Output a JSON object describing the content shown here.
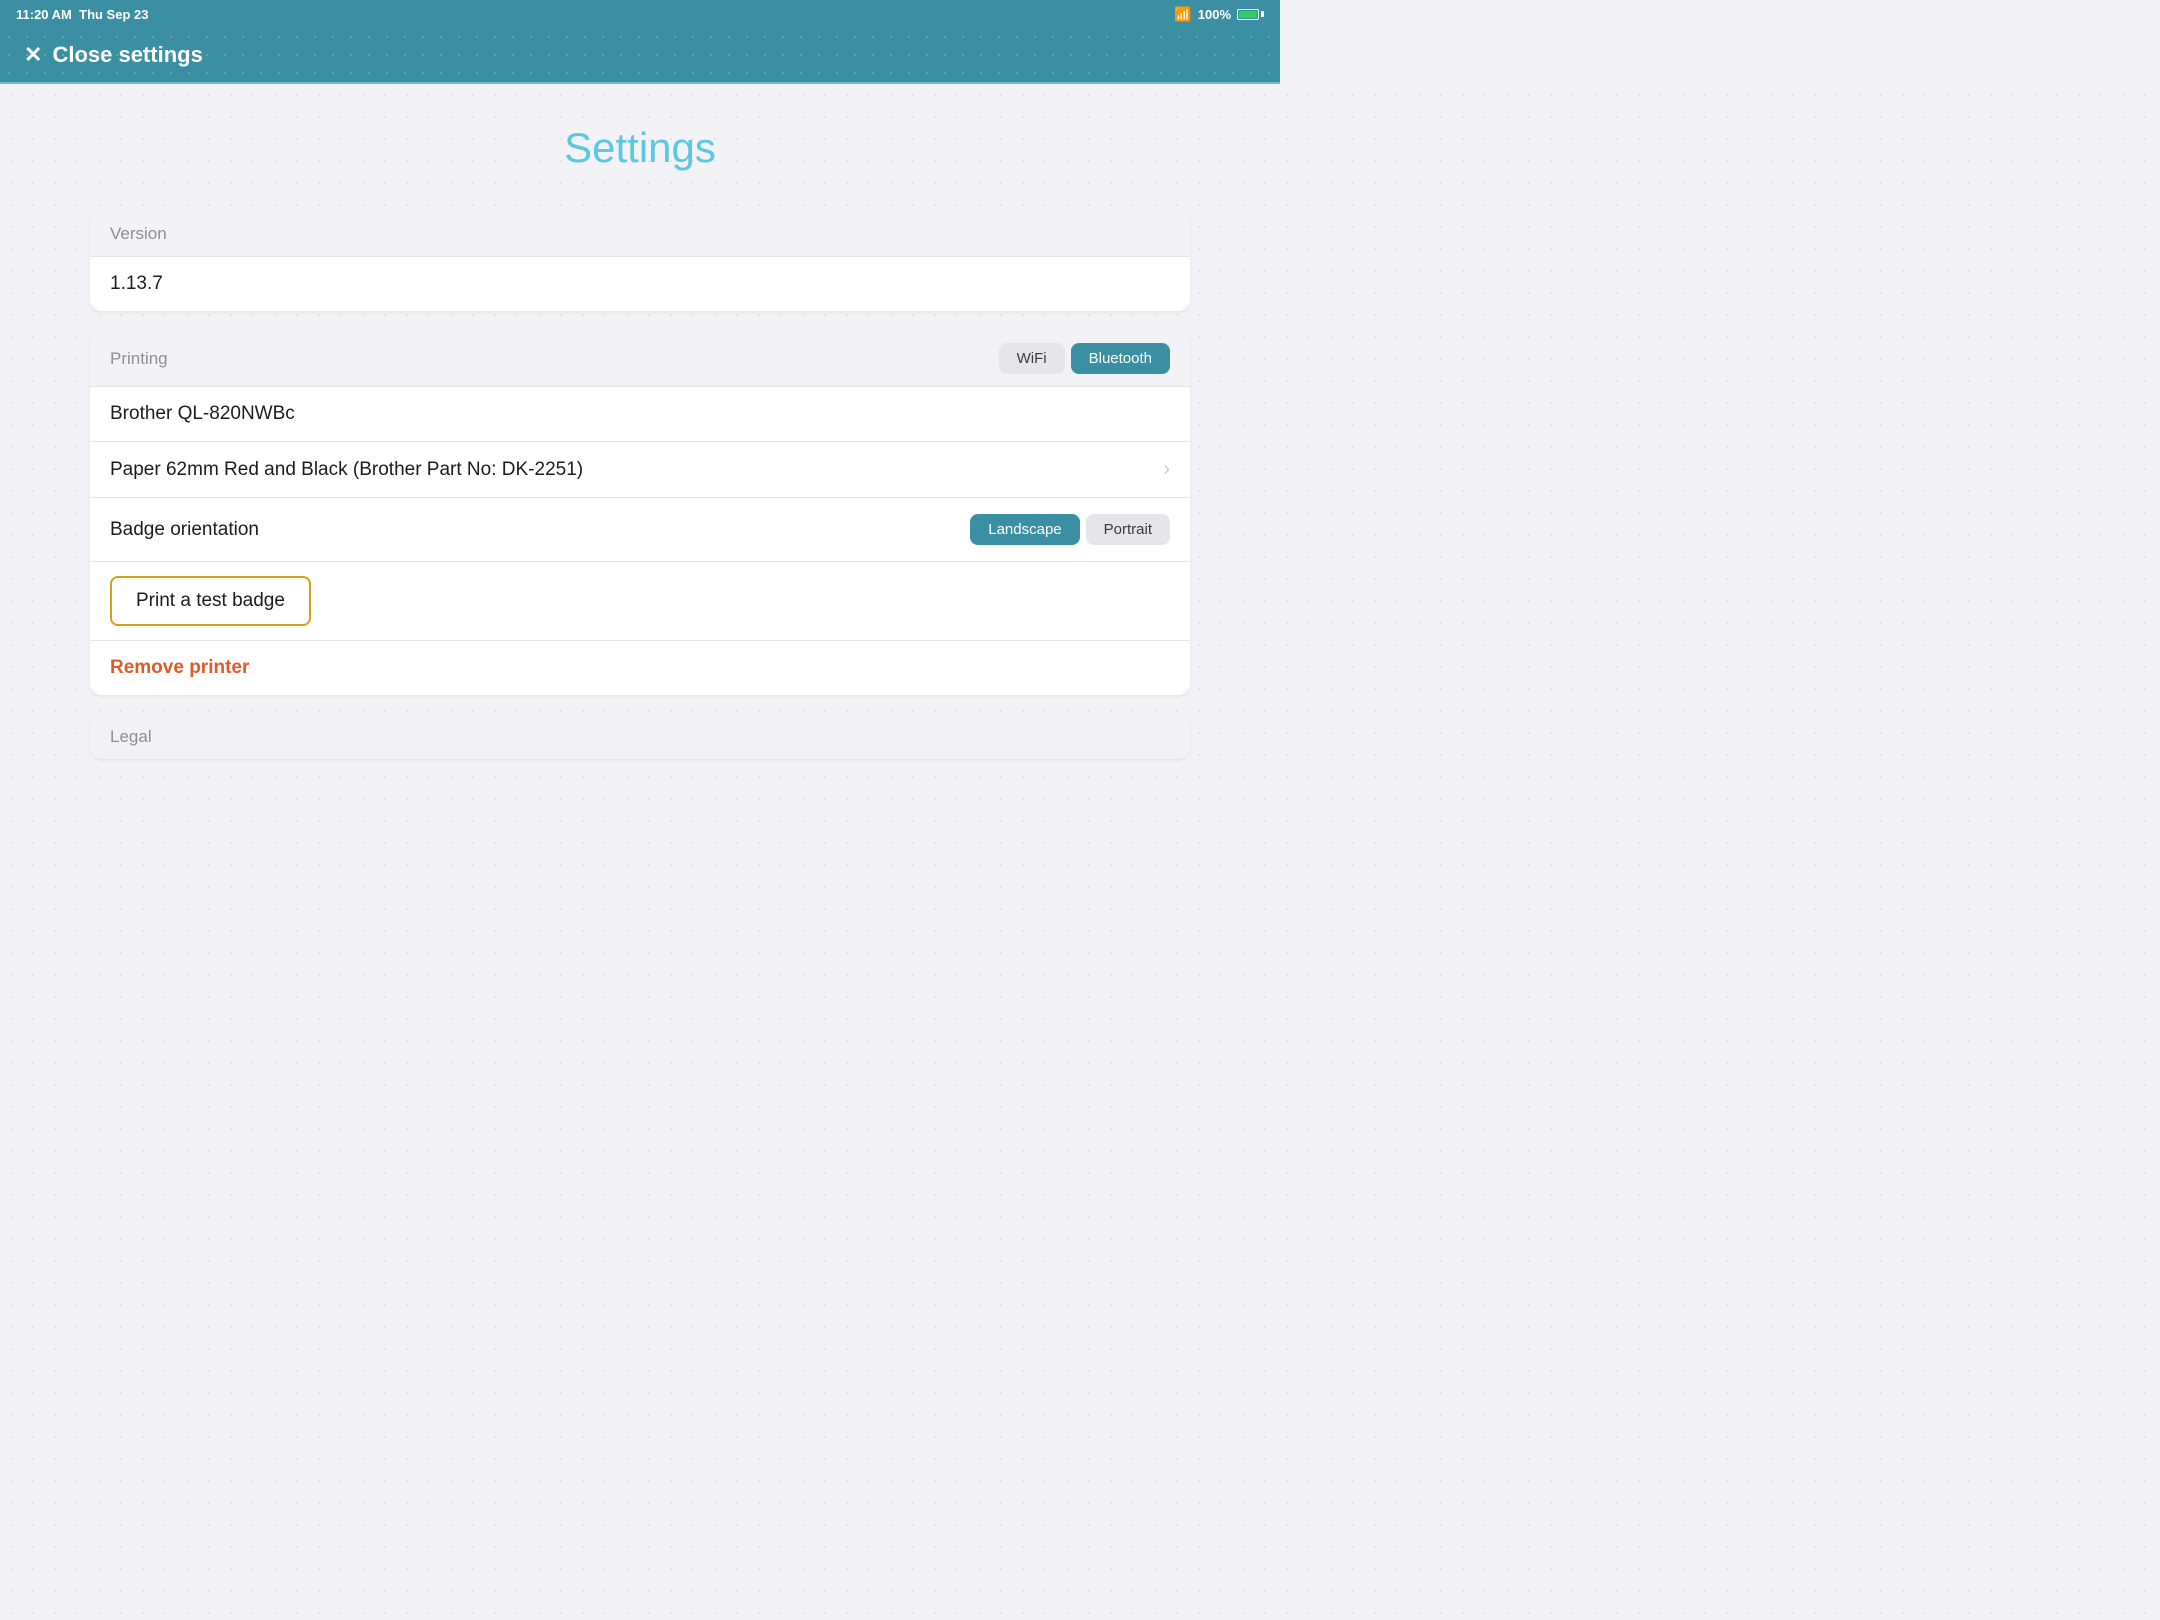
{
  "statusBar": {
    "time": "11:20 AM",
    "date": "Thu Sep 23",
    "wifi": "WiFi",
    "batteryPercent": "100%"
  },
  "header": {
    "closeLabel": "Close settings"
  },
  "page": {
    "title": "Settings"
  },
  "sections": {
    "version": {
      "label": "Version",
      "value": "1.13.7"
    },
    "printing": {
      "label": "Printing",
      "wifiBtn": "WiFi",
      "bluetoothBtn": "Bluetooth",
      "activeMode": "Bluetooth",
      "printerName": "Brother QL-820NWBc",
      "paperLabel": "Paper 62mm Red and Black (Brother Part No: DK-2251)",
      "badgeOrientationLabel": "Badge orientation",
      "landscapeBtn": "Landscape",
      "portraitBtn": "Portrait",
      "activeOrientation": "Landscape",
      "printTestLabel": "Print a test badge",
      "removePrinterLabel": "Remove printer"
    },
    "legal": {
      "label": "Legal"
    }
  }
}
